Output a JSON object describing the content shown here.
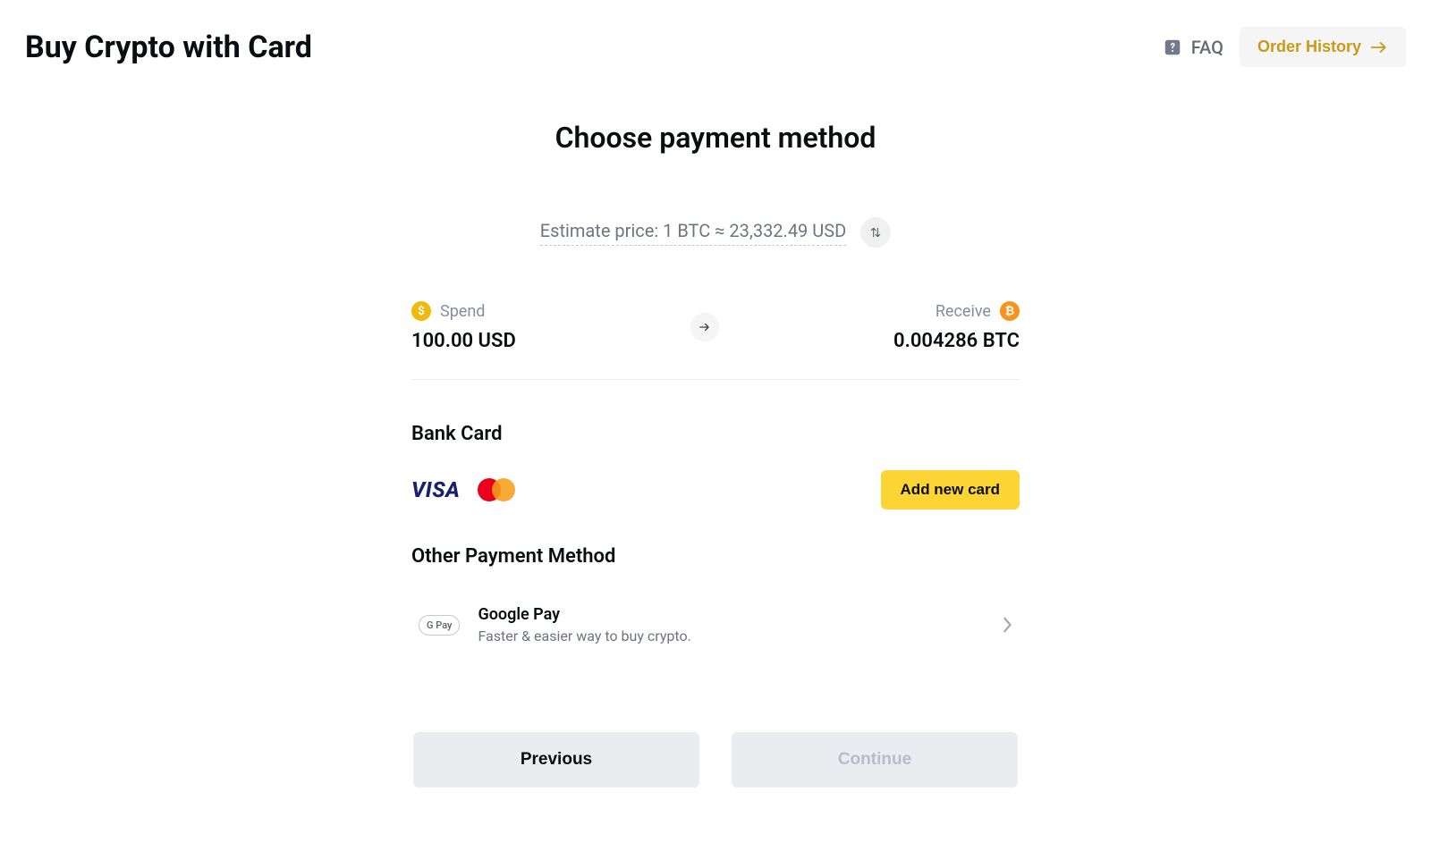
{
  "header": {
    "title": "Buy Crypto with Card",
    "faq_label": "FAQ",
    "order_history_label": "Order History"
  },
  "main": {
    "section_title": "Choose payment method",
    "estimate_text": "Estimate price: 1 BTC ≈ 23,332.49 USD",
    "spend_label": "Spend",
    "spend_value": "100.00 USD",
    "receive_label": "Receive",
    "receive_value": "0.004286 BTC",
    "bank_card_title": "Bank Card",
    "add_card_label": "Add new card",
    "other_title": "Other Payment Method",
    "gpay": {
      "badge": "G Pay",
      "title": "Google Pay",
      "subtitle": "Faster & easier way to buy crypto."
    }
  },
  "footer": {
    "previous_label": "Previous",
    "continue_label": "Continue"
  },
  "colors": {
    "accent_yellow": "#fcd535",
    "brand_text_yellow": "#c89a17",
    "btc_orange": "#f7931a",
    "visa_blue": "#1a1f71"
  }
}
